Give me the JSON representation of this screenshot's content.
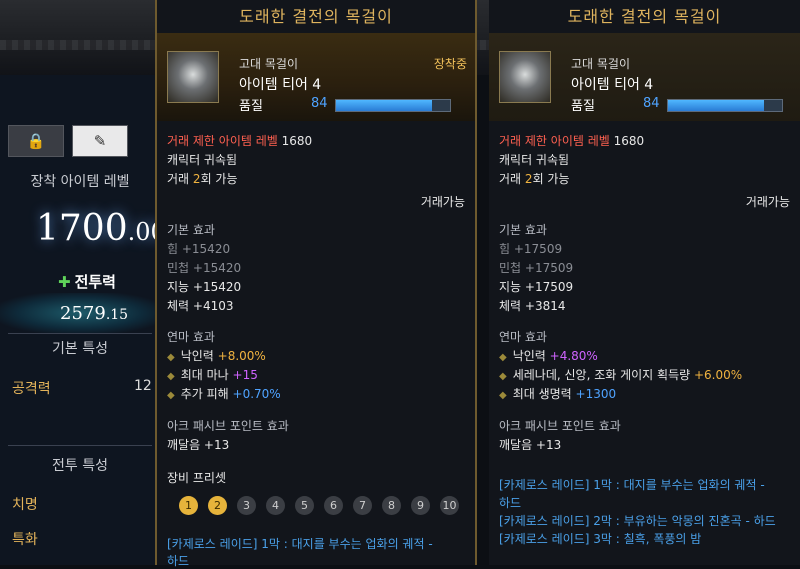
{
  "left": {
    "tabs": [
      "🔒",
      "✎"
    ],
    "equip_level_label": "장착 아이템 레벨",
    "item_level_int": "1700",
    "item_level_dec": ".00",
    "combat_power_label": "전투력",
    "combat_power_int": "2579",
    "combat_power_dec": ".15",
    "basic_title": "기본 특성",
    "attack_label": "공격력",
    "attack_value": "12",
    "combat_title": "전투 특성",
    "crit_label": "치명",
    "spec_label": "특화"
  },
  "tooltip1": {
    "title": "도래한 결전의 목걸이",
    "item_type": "고대 목걸이",
    "tier": "아이템 티어 4",
    "equipped": "장착중",
    "quality_label": "품질",
    "quality_value": "84",
    "quality_fraction": 0.84,
    "ilvl_prefix": "거래 제한 아이템 레벨",
    "ilvl_value": "1680",
    "bound": "캐릭터 귀속됨",
    "trade_prefix": "거래",
    "trade_count": "2",
    "trade_suffix": "회 가능",
    "tradable": "거래가능",
    "base_title": "기본 효과",
    "base": [
      {
        "label": "힘 +15420",
        "muted": true
      },
      {
        "label": "민첩 +15420",
        "muted": true
      },
      {
        "label": "지능 +15420",
        "muted": false
      },
      {
        "label": "체력 +4103",
        "muted": false
      }
    ],
    "refine_title": "연마 효과",
    "refine": [
      {
        "name": "낙인력",
        "value": "+8.00%",
        "color": "orange"
      },
      {
        "name": "최대 마나",
        "value": "+15",
        "color": "purple"
      },
      {
        "name": "추가 피해",
        "value": "+0.70%",
        "color": "blue"
      }
    ],
    "ark_title": "아크 패시브 포인트 효과",
    "ark_value": "깨달음 +13",
    "preset_title": "장비 프리셋",
    "presets": [
      "1",
      "2",
      "3",
      "4",
      "5",
      "6",
      "7",
      "8",
      "9",
      "10"
    ],
    "active_presets": [
      0,
      1
    ],
    "raid_line1": "[카제로스 레이드] 1막 : 대지를 부수는 업화의 궤적 -",
    "raid_line2": "하드"
  },
  "tooltip2": {
    "title": "도래한 결전의 목걸이",
    "item_type": "고대 목걸이",
    "tier": "아이템 티어 4",
    "quality_label": "품질",
    "quality_value": "84",
    "quality_fraction": 0.84,
    "ilvl_prefix": "거래 제한 아이템 레벨",
    "ilvl_value": "1680",
    "bound": "캐릭터 귀속됨",
    "trade_prefix": "거래",
    "trade_count": "2",
    "trade_suffix": "회 가능",
    "tradable": "거래가능",
    "base_title": "기본 효과",
    "base": [
      {
        "label": "힘 +17509",
        "muted": true
      },
      {
        "label": "민첩 +17509",
        "muted": true
      },
      {
        "label": "지능 +17509",
        "muted": false
      },
      {
        "label": "체력 +3814",
        "muted": false
      }
    ],
    "refine_title": "연마 효과",
    "refine": [
      {
        "name": "낙인력",
        "value": "+4.80%",
        "color": "purple"
      },
      {
        "name": "세레나데, 신앙, 조화 게이지 획득량",
        "value": "+6.00%",
        "color": "orange"
      },
      {
        "name": "최대 생명력",
        "value": "+1300",
        "color": "blue"
      }
    ],
    "ark_title": "아크 패시브 포인트 효과",
    "ark_value": "깨달음 +13",
    "raid_lines": [
      "[카제로스 레이드] 1막 : 대지를 부수는 업화의 궤적 -",
      "하드",
      "[카제로스 레이드] 2막 : 부유하는 악몽의 진혼곡 - 하드",
      "[카제로스 레이드] 3막 : 칠흑, 폭풍의 밤"
    ]
  }
}
